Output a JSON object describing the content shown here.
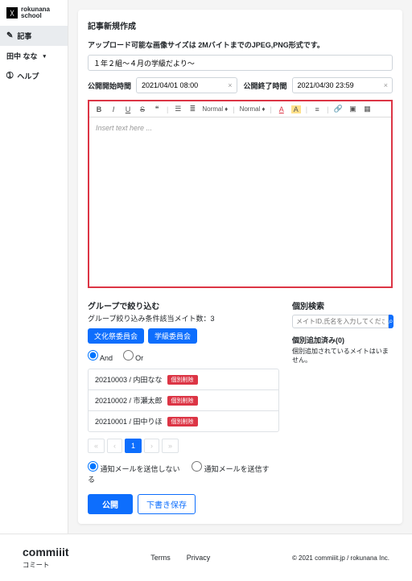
{
  "brand": {
    "name": "rokunana\nschool"
  },
  "nav": {
    "articles": "記事",
    "user": "田中 なな",
    "help": "ヘルプ"
  },
  "page": {
    "title": "記事新規作成"
  },
  "upload_hint": "アップロード可能な画像サイズは 2MバイトまでのJPEG,PNG形式です。",
  "title_value": "１年２組〜４月の学級だより〜",
  "start": {
    "label": "公開開始時間",
    "value": "2021/04/01 08:00"
  },
  "end": {
    "label": "公開終了時間",
    "value": "2021/04/30 23:59"
  },
  "toolbar": {
    "style1": "Normal",
    "style2": "Normal"
  },
  "editor": {
    "placeholder": "Insert text here ..."
  },
  "group": {
    "title": "グループで絞り込む",
    "sub": "グループ絞り込み条件該当メイト数：3",
    "tags": [
      "文化祭委員会",
      "学級委員会"
    ],
    "logic": {
      "and": "And",
      "or": "Or"
    }
  },
  "rows": [
    {
      "text": "20210003 / 内田なな",
      "del": "個別削除"
    },
    {
      "text": "20210002 / 市瀬太郎",
      "del": "個別削除"
    },
    {
      "text": "20210001 / 田中りほ",
      "del": "個別削除"
    }
  ],
  "pager": {
    "page": "1"
  },
  "notify": {
    "off": "通知メールを送信しない",
    "on": "通知メールを送信する"
  },
  "actions": {
    "publish": "公開",
    "draft": "下書き保存"
  },
  "search": {
    "title": "個別検索",
    "placeholder": "メイトID,氏名を入力してください"
  },
  "added": {
    "title": "個別追加済み(0)",
    "empty": "個別追加されているメイトはいません。"
  },
  "footer": {
    "logo": "commiiit",
    "sub": "コミート",
    "terms": "Terms",
    "privacy": "Privacy",
    "copy": "© 2021 commiiit.jp / rokunana Inc."
  }
}
